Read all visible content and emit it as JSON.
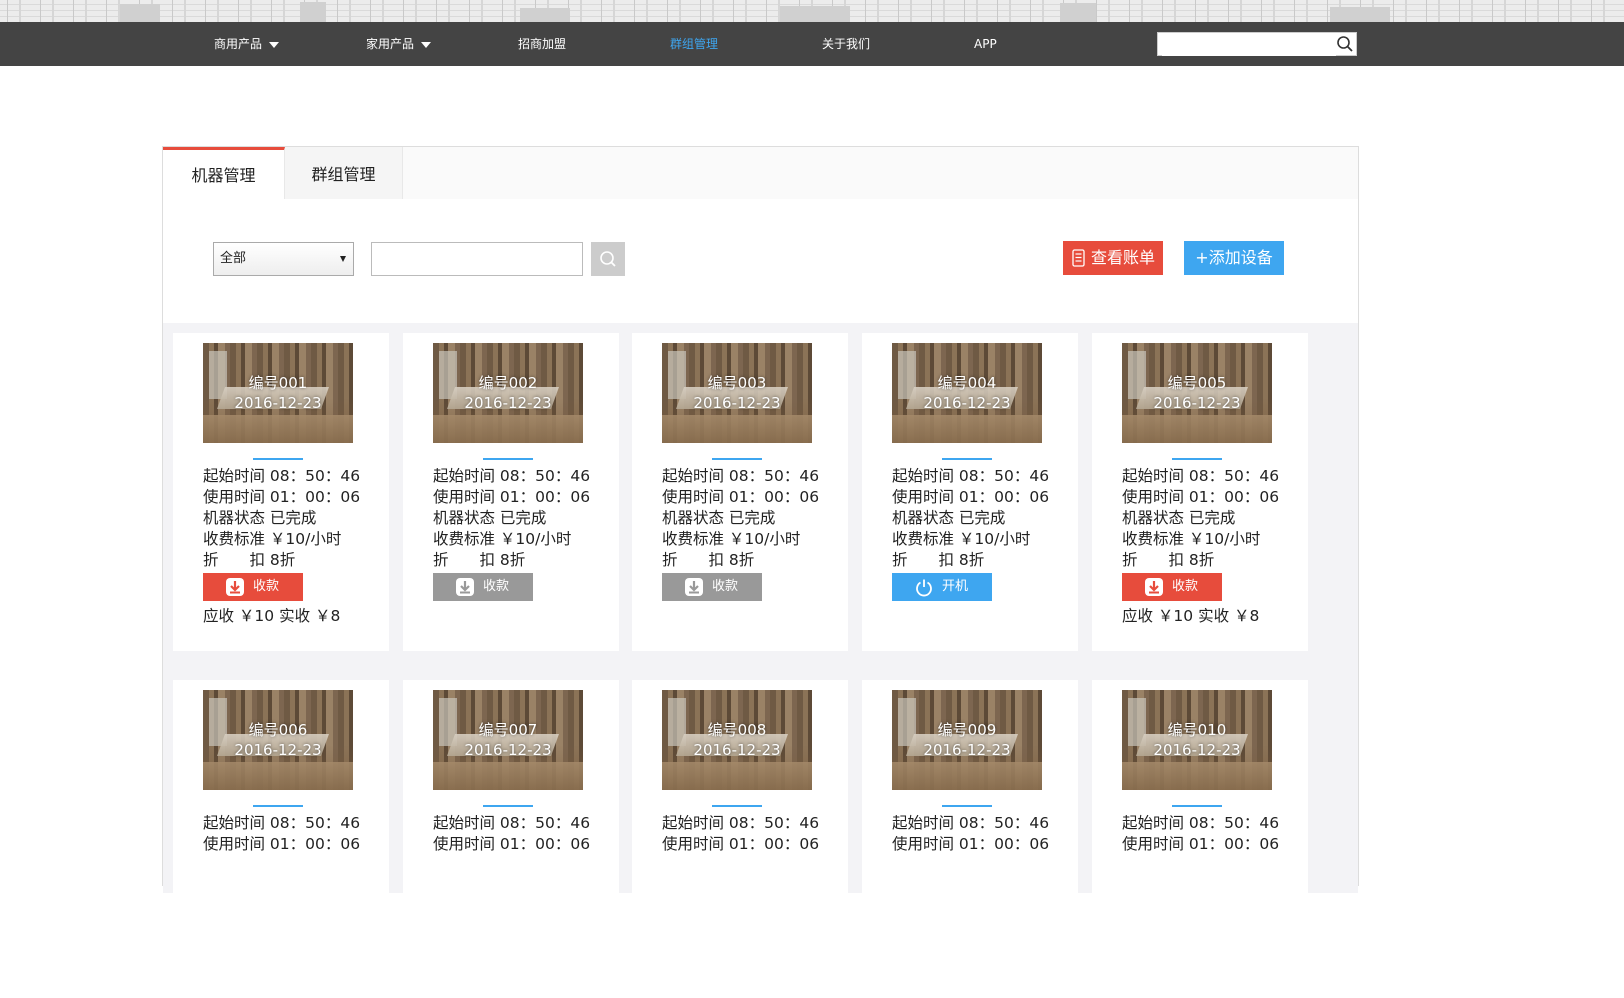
{
  "nav": {
    "items": [
      {
        "label": "商用产品",
        "dropdown": true
      },
      {
        "label": "家用产品",
        "dropdown": true
      },
      {
        "label": "招商加盟",
        "dropdown": false
      },
      {
        "label": "群组管理",
        "dropdown": false,
        "active": true
      },
      {
        "label": "关于我们",
        "dropdown": false
      },
      {
        "label": "APP",
        "dropdown": false
      }
    ],
    "search_value": ""
  },
  "tabs": [
    {
      "label": "机器管理",
      "active": true
    },
    {
      "label": "群组管理",
      "active": false
    }
  ],
  "filter": {
    "select_value": "全部",
    "search_value": ""
  },
  "buttons": {
    "bill": "查看账单",
    "add": "+添加设备"
  },
  "colors": {
    "accent_blue": "#3ea6f0",
    "accent_red": "#e74c3c",
    "disabled_gray": "#999999",
    "nav_bg": "#444444"
  },
  "devices": [
    {
      "id": "编号001",
      "date": "2016-12-23",
      "start": "起始时间 08：50：46",
      "used": "使用时间 01：00：06",
      "status": "机器状态 已完成",
      "fee": "收费标准 ￥10/小时",
      "discount": "折　　扣 8折",
      "action": "收款",
      "action_style": "red",
      "action_icon": "download-icon",
      "amount": "应收 ￥10 实收 ￥8"
    },
    {
      "id": "编号002",
      "date": "2016-12-23",
      "start": "起始时间 08：50：46",
      "used": "使用时间 01：00：06",
      "status": "机器状态 已完成",
      "fee": "收费标准 ￥10/小时",
      "discount": "折　　扣 8折",
      "action": "收款",
      "action_style": "gray",
      "action_icon": "download-icon",
      "amount": ""
    },
    {
      "id": "编号003",
      "date": "2016-12-23",
      "start": "起始时间 08：50：46",
      "used": "使用时间 01：00：06",
      "status": "机器状态 已完成",
      "fee": "收费标准 ￥10/小时",
      "discount": "折　　扣 8折",
      "action": "收款",
      "action_style": "gray",
      "action_icon": "download-icon",
      "amount": ""
    },
    {
      "id": "编号004",
      "date": "2016-12-23",
      "start": "起始时间 08：50：46",
      "used": "使用时间 01：00：06",
      "status": "机器状态 已完成",
      "fee": "收费标准 ￥10/小时",
      "discount": "折　　扣 8折",
      "action": "开机",
      "action_style": "blue",
      "action_icon": "power-icon",
      "amount": ""
    },
    {
      "id": "编号005",
      "date": "2016-12-23",
      "start": "起始时间 08：50：46",
      "used": "使用时间 01：00：06",
      "status": "机器状态 已完成",
      "fee": "收费标准 ￥10/小时",
      "discount": "折　　扣 8折",
      "action": "收款",
      "action_style": "red",
      "action_icon": "download-icon",
      "amount": "应收 ￥10 实收 ￥8"
    },
    {
      "id": "编号006",
      "date": "2016-12-23",
      "start": "起始时间 08：50：46",
      "used": "使用时间 01：00：06"
    },
    {
      "id": "编号007",
      "date": "2016-12-23",
      "start": "起始时间 08：50：46",
      "used": "使用时间 01：00：06"
    },
    {
      "id": "编号008",
      "date": "2016-12-23",
      "start": "起始时间 08：50：46",
      "used": "使用时间 01：00：06"
    },
    {
      "id": "编号009",
      "date": "2016-12-23",
      "start": "起始时间 08：50：46",
      "used": "使用时间 01：00：06"
    },
    {
      "id": "编号010",
      "date": "2016-12-23",
      "start": "起始时间 08：50：46",
      "used": "使用时间 01：00：06"
    }
  ]
}
